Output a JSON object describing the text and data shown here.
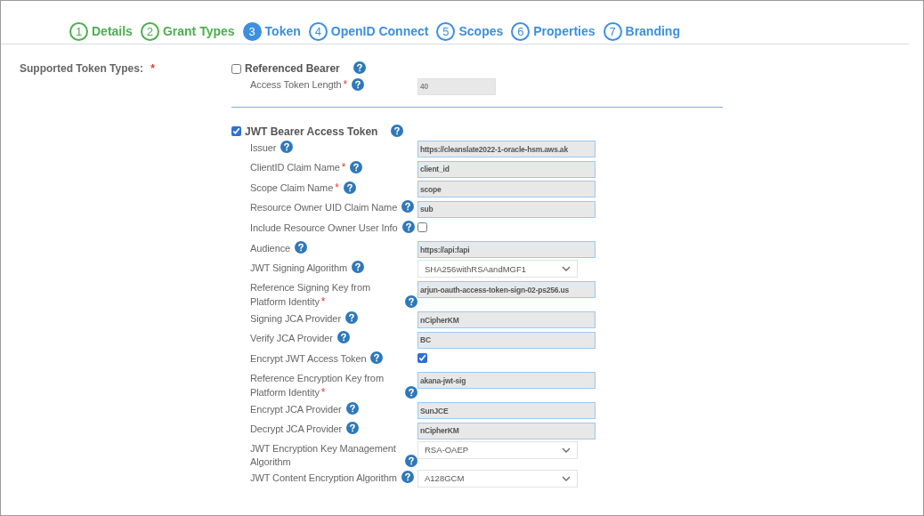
{
  "steps": [
    {
      "number": "1",
      "label": "Details",
      "completed": true,
      "selected": false
    },
    {
      "number": "2",
      "label": "Grant Types",
      "completed": true,
      "selected": false
    },
    {
      "number": "3",
      "label": "Token",
      "selected": true
    },
    {
      "number": "4",
      "label": "OpenID Connect",
      "completed": false,
      "selected": false
    },
    {
      "number": "5",
      "label": "Scopes",
      "completed": false,
      "selected": false
    },
    {
      "number": "6",
      "label": "Properties",
      "completed": false,
      "selected": false
    },
    {
      "number": "7",
      "label": "Branding",
      "completed": false,
      "selected": false
    }
  ],
  "section": {
    "label": "Supported Token Types:",
    "required_mark": "*"
  },
  "token_types": [
    {
      "label": "Referenced Bearer",
      "checked": false,
      "fields": [
        {
          "label": "Access Token Length",
          "required_mark": "*",
          "kind": "text",
          "value": "40",
          "disabled": true
        }
      ]
    },
    {
      "label": "JWT Bearer Access Token",
      "checked": true,
      "fields": [
        {
          "label": "Issuer",
          "kind": "text",
          "value": "https://cleanslate2022-1-oracle-hsm.aws.ak",
          "disabled": false
        },
        {
          "label": "ClientID Claim Name",
          "required_mark": "*",
          "kind": "text",
          "value": "client_id",
          "disabled": false
        },
        {
          "label": "Scope Claim Name",
          "required_mark": "*",
          "kind": "text",
          "value": "scope",
          "disabled": false
        },
        {
          "label": "Resource Owner UID Claim Name",
          "kind": "text",
          "value": "sub",
          "disabled": false
        },
        {
          "label": "Include Resource Owner User Info",
          "kind": "checkbox",
          "checked": false
        },
        {
          "label": "Audience",
          "kind": "text",
          "value": "https://api:fapi",
          "disabled": false
        },
        {
          "label": "JWT Signing Algorithm",
          "kind": "select",
          "value": "SHA256withRSAandMGF1"
        },
        {
          "label": "Reference Signing Key from Platform Identity",
          "required_mark": "*",
          "kind": "text",
          "value": "arjun-oauth-access-token-sign-02-ps256.us",
          "disabled": false
        },
        {
          "label": "Signing JCA Provider",
          "kind": "text",
          "value": "nCipherKM",
          "disabled": false
        },
        {
          "label": "Verify JCA Provider",
          "kind": "text",
          "value": "BC",
          "disabled": false
        },
        {
          "label": "Encrypt JWT Access Token",
          "kind": "checkbox",
          "checked": true
        },
        {
          "label": "Reference Encryption Key from Platform Identity",
          "required_mark": "*",
          "kind": "text",
          "value": "akana-jwt-sig",
          "disabled": false
        },
        {
          "label": "Encrypt JCA Provider",
          "kind": "text",
          "value": "SunJCE",
          "disabled": false
        },
        {
          "label": "Decrypt JCA Provider",
          "kind": "text",
          "value": "nCipherKM",
          "disabled": false
        },
        {
          "label": "JWT Encryption Key Management Algorithm",
          "kind": "select",
          "value": "RSA-OAEP"
        },
        {
          "label": "JWT Content Encryption Algorithm",
          "kind": "select",
          "value": "A128GCM"
        }
      ]
    }
  ]
}
